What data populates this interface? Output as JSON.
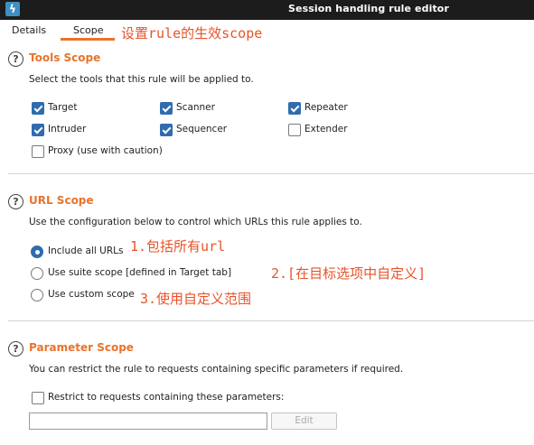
{
  "window": {
    "title": "Session handling rule editor",
    "app_icon": "burp-icon"
  },
  "tabs": [
    {
      "label": "Details"
    },
    {
      "label": "Scope"
    }
  ],
  "annotations": {
    "a0": "设置rule的生效scope",
    "a1": "1.包括所有url",
    "a2": "2.[在目标选项中自定义]",
    "a3": "3.使用自定义范围",
    "color": "#e8532a"
  },
  "tools_scope": {
    "title": "Tools Scope",
    "description": "Select the tools that this rule will be applied to.",
    "tools": [
      {
        "label": "Target",
        "checked": true
      },
      {
        "label": "Scanner",
        "checked": true
      },
      {
        "label": "Repeater",
        "checked": true
      },
      {
        "label": "Intruder",
        "checked": true
      },
      {
        "label": "Sequencer",
        "checked": true
      },
      {
        "label": "Extender",
        "checked": false
      },
      {
        "label": "Proxy (use with caution)",
        "checked": false
      }
    ]
  },
  "url_scope": {
    "title": "URL Scope",
    "description": "Use the configuration below to control which URLs this rule applies to.",
    "options": [
      {
        "label": "Include all URLs",
        "selected": true
      },
      {
        "label": "Use suite scope [defined in Target tab]",
        "selected": false
      },
      {
        "label": "Use custom scope",
        "selected": false
      }
    ]
  },
  "parameter_scope": {
    "title": "Parameter Scope",
    "description": "You can restrict the rule to requests containing specific parameters if required.",
    "restrict_label": "Restrict to requests containing these parameters:",
    "restrict_checked": false,
    "param_value": "",
    "edit_label": "Edit"
  },
  "help_glyph": "?",
  "colors": {
    "accent": "#e8732c",
    "checkbox": "#2f6cae",
    "titlebar": "#1c1c1c"
  }
}
